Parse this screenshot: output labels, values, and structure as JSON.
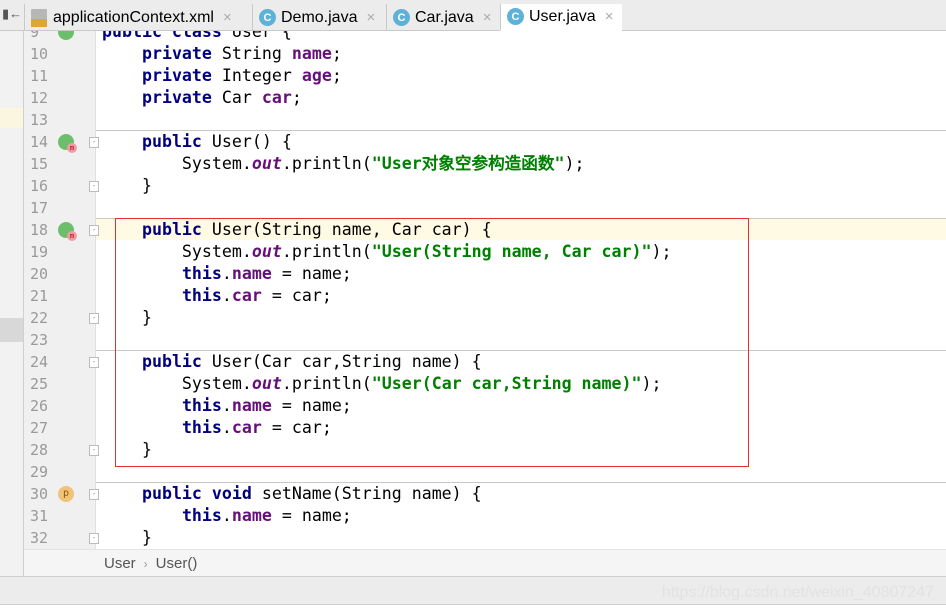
{
  "tabs": [
    {
      "label": "applicationContext.xml",
      "icon": "xml-file-icon",
      "active": false
    },
    {
      "label": "Demo.java",
      "icon": "java-class-icon",
      "active": false
    },
    {
      "label": "Car.java",
      "icon": "java-class-icon",
      "active": false
    },
    {
      "label": "User.java",
      "icon": "java-class-icon",
      "active": true
    }
  ],
  "left_tab_label": "▮←",
  "lines": [
    {
      "n": "9",
      "t": [
        [
          "kw",
          "public class "
        ],
        [
          "",
          "User {"
        ]
      ]
    },
    {
      "n": "10",
      "t": [
        [
          "",
          "    "
        ],
        [
          "kw",
          "private "
        ],
        [
          "",
          "String "
        ],
        [
          "fld",
          "name"
        ],
        [
          "",
          ";"
        ]
      ]
    },
    {
      "n": "11",
      "t": [
        [
          "",
          "    "
        ],
        [
          "kw",
          "private "
        ],
        [
          "",
          "Integer "
        ],
        [
          "fld",
          "age"
        ],
        [
          "",
          ";"
        ]
      ]
    },
    {
      "n": "12",
      "t": [
        [
          "",
          "    "
        ],
        [
          "kw",
          "private "
        ],
        [
          "",
          "Car "
        ],
        [
          "fld",
          "car"
        ],
        [
          "",
          ";"
        ]
      ]
    },
    {
      "n": "13",
      "t": []
    },
    {
      "n": "14",
      "t": [
        [
          "",
          "    "
        ],
        [
          "kw",
          "public "
        ],
        [
          "",
          "User() {"
        ]
      ]
    },
    {
      "n": "15",
      "t": [
        [
          "",
          "        System."
        ],
        [
          "stat",
          "out"
        ],
        [
          "",
          ".println("
        ],
        [
          "st",
          "\"User对象空参构造函数\""
        ],
        [
          "",
          ");"
        ]
      ]
    },
    {
      "n": "16",
      "t": [
        [
          "",
          "    }"
        ]
      ]
    },
    {
      "n": "17",
      "t": []
    },
    {
      "n": "18",
      "t": [
        [
          "",
          "    "
        ],
        [
          "kw",
          "public "
        ],
        [
          "",
          "User(String name, Car car) {"
        ]
      ]
    },
    {
      "n": "19",
      "t": [
        [
          "",
          "        System."
        ],
        [
          "stat",
          "out"
        ],
        [
          "",
          ".println("
        ],
        [
          "st",
          "\"User(String name, Car car)\""
        ],
        [
          "",
          ");"
        ]
      ]
    },
    {
      "n": "20",
      "t": [
        [
          "",
          "        "
        ],
        [
          "kw",
          "this"
        ],
        [
          "",
          "."
        ],
        [
          "fld",
          "name"
        ],
        [
          "",
          " = name;"
        ]
      ]
    },
    {
      "n": "21",
      "t": [
        [
          "",
          "        "
        ],
        [
          "kw",
          "this"
        ],
        [
          "",
          "."
        ],
        [
          "fld",
          "car"
        ],
        [
          "",
          " = car;"
        ]
      ]
    },
    {
      "n": "22",
      "t": [
        [
          "",
          "    }"
        ]
      ]
    },
    {
      "n": "23",
      "t": []
    },
    {
      "n": "24",
      "t": [
        [
          "",
          "    "
        ],
        [
          "kw",
          "public "
        ],
        [
          "",
          "User(Car car,String name) {"
        ]
      ]
    },
    {
      "n": "25",
      "t": [
        [
          "",
          "        System."
        ],
        [
          "stat",
          "out"
        ],
        [
          "",
          ".println("
        ],
        [
          "st",
          "\"User(Car car,String name)\""
        ],
        [
          "",
          ");"
        ]
      ]
    },
    {
      "n": "26",
      "t": [
        [
          "",
          "        "
        ],
        [
          "kw",
          "this"
        ],
        [
          "",
          "."
        ],
        [
          "fld",
          "name"
        ],
        [
          "",
          " = name;"
        ]
      ]
    },
    {
      "n": "27",
      "t": [
        [
          "",
          "        "
        ],
        [
          "kw",
          "this"
        ],
        [
          "",
          "."
        ],
        [
          "fld",
          "car"
        ],
        [
          "",
          " = car;"
        ]
      ]
    },
    {
      "n": "28",
      "t": [
        [
          "",
          "    }"
        ]
      ]
    },
    {
      "n": "29",
      "t": []
    },
    {
      "n": "30",
      "t": [
        [
          "",
          "    "
        ],
        [
          "kw",
          "public void "
        ],
        [
          "",
          "setName(String name) {"
        ]
      ]
    },
    {
      "n": "31",
      "t": [
        [
          "",
          "        "
        ],
        [
          "kw",
          "this"
        ],
        [
          "",
          "."
        ],
        [
          "fld",
          "name"
        ],
        [
          "",
          " = name;"
        ]
      ]
    },
    {
      "n": "32",
      "t": [
        [
          "",
          "    }"
        ]
      ]
    }
  ],
  "gutter_icons": {
    "9": "spring-bean-icon",
    "14": "spring-method-icon",
    "18": "spring-method-icon",
    "30": "property-icon"
  },
  "folds": {
    "14": "-",
    "16": "-",
    "18": "-",
    "22": "-",
    "24": "-",
    "28": "-",
    "30": "-",
    "32": "-"
  },
  "current_line": "18",
  "breadcrumb": {
    "items": [
      "User",
      "User()"
    ]
  },
  "watermark": "https://blog.csdn.net/weixin_40807247",
  "colors": {
    "keyword": "#000080",
    "field": "#660e7a",
    "string": "#008000",
    "highlight": "#fffae3",
    "annotation_box": "#e03030"
  }
}
